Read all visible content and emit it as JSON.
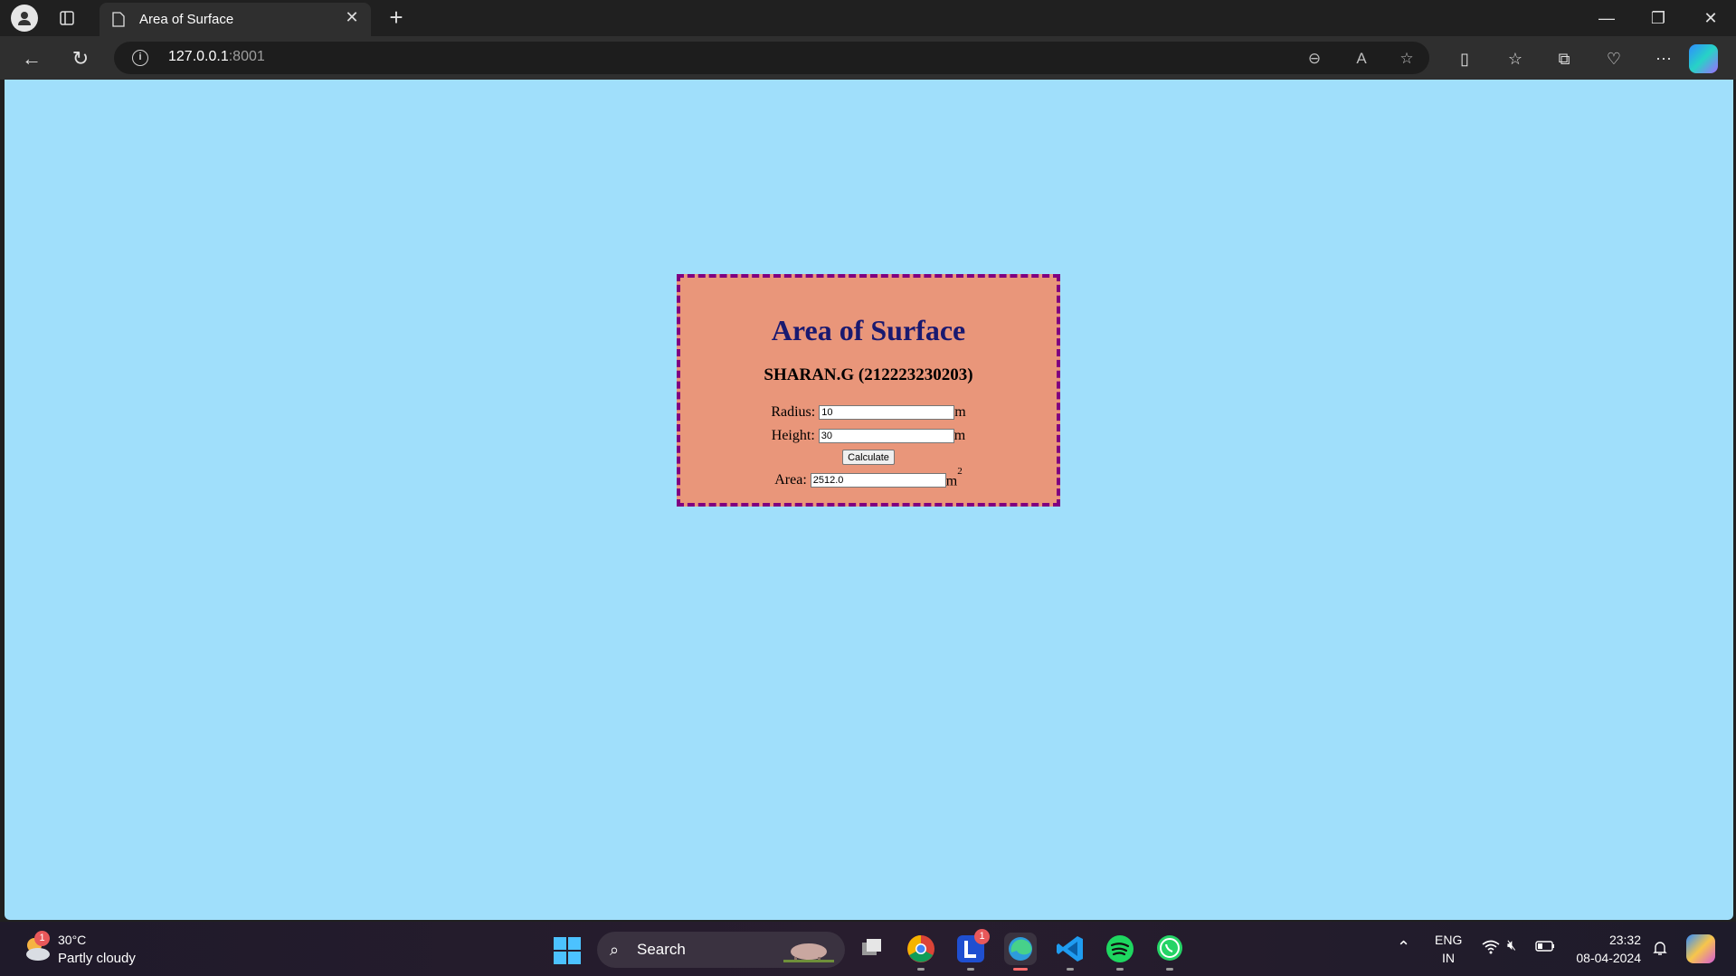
{
  "browser": {
    "tab_title": "Area of Surface",
    "url_host": "127.0.0.1",
    "url_port": ":8001"
  },
  "page": {
    "heading": "Area of Surface",
    "author": "SHARAN.G (212223230203)",
    "radius_label": "Radius:",
    "radius_value": "10",
    "radius_unit": "m",
    "height_label": "Height:",
    "height_value": "30",
    "height_unit": "m",
    "calculate_label": "Calculate",
    "area_label": "Area:",
    "area_value": "2512.0",
    "area_unit": "m",
    "area_unit_sup": "2"
  },
  "taskbar": {
    "weather_badge": "1",
    "temperature": "30°C",
    "condition": "Partly cloudy",
    "search_label": "Search",
    "app_badge": "1",
    "language_primary": "ENG",
    "language_secondary": "IN",
    "time": "23:32",
    "date": "08-04-2024"
  },
  "colors": {
    "page_bg": "#a0dffb",
    "card_bg": "#e9967a",
    "card_border": "#800080",
    "heading_color": "#191970"
  }
}
